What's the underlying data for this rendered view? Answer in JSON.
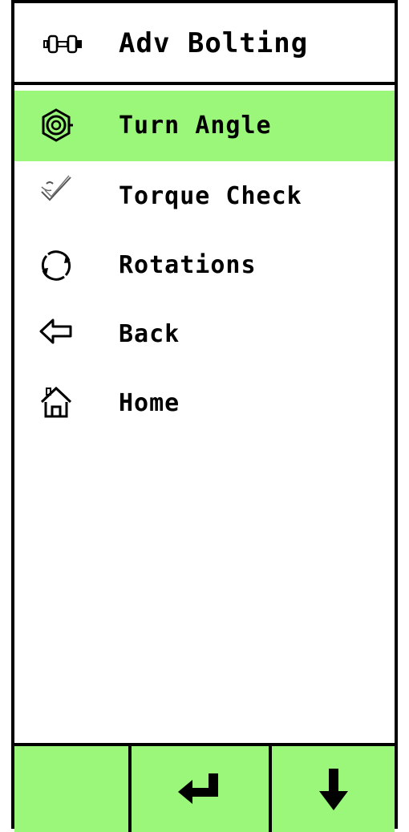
{
  "theme": {
    "accent": "#9bf779"
  },
  "header": {
    "icon": "bolt-wrench-icon",
    "title": "Adv Bolting"
  },
  "menu": {
    "items": [
      {
        "icon": "nut-icon",
        "label": "Turn Angle",
        "selected": true
      },
      {
        "icon": "checkmark-wrench-icon",
        "label": "Torque Check",
        "selected": false
      },
      {
        "icon": "rotate-icon",
        "label": "Rotations",
        "selected": false
      },
      {
        "icon": "back-arrow-icon",
        "label": "Back",
        "selected": false
      },
      {
        "icon": "home-icon",
        "label": "Home",
        "selected": false
      }
    ]
  },
  "softkeys": [
    {
      "icon": "",
      "label": ""
    },
    {
      "icon": "enter-icon"
    },
    {
      "icon": "down-arrow-icon"
    }
  ]
}
